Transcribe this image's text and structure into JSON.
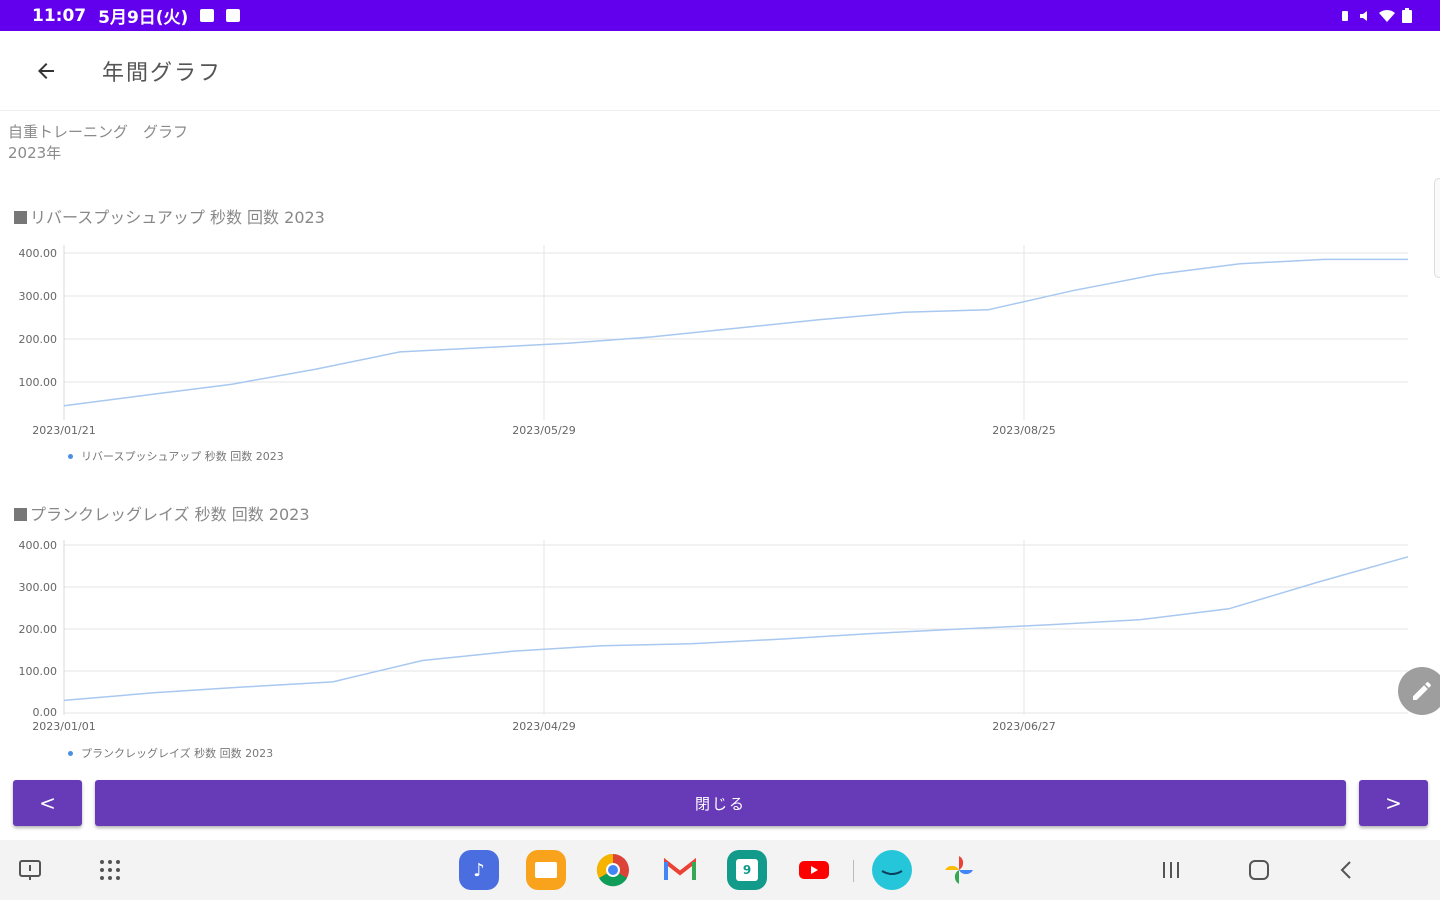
{
  "status": {
    "time": "11:07",
    "date": "5月9日(火)"
  },
  "app": {
    "title": "年間グラフ"
  },
  "subtitle": {
    "line1": "自重トレーニング　グラフ",
    "line2": "2023年"
  },
  "charts": [
    {
      "title": "リバースプッシュアップ 秒数 回数 2023",
      "legend": "リバースプッシュアップ 秒数 回数 2023",
      "yticks": [
        "400.00",
        "300.00",
        "200.00",
        "100.00"
      ],
      "xticks": [
        "2023/01/21",
        "2023/05/29",
        "2023/08/25"
      ]
    },
    {
      "title": "プランクレッグレイズ 秒数 回数 2023",
      "legend": "プランクレッグレイズ 秒数 回数 2023",
      "yticks": [
        "400.00",
        "300.00",
        "200.00",
        "100.00",
        "0.00"
      ],
      "xticks": [
        "2023/01/01",
        "2023/04/29",
        "2023/06/27"
      ]
    }
  ],
  "chart_data": [
    {
      "type": "line",
      "title": "リバースプッシュアップ 秒数 回数 2023",
      "ylim": [
        0,
        400
      ],
      "yticks": [
        100,
        200,
        300,
        400
      ],
      "grid": true,
      "legend_position": "bottom-left",
      "series": [
        {
          "name": "リバースプッシュアップ 秒数 回数 2023",
          "color": "#a8c8f0",
          "values": [
            45,
            70,
            95,
            130,
            170,
            180,
            190,
            205,
            225,
            245,
            262,
            268,
            312,
            350,
            375,
            385,
            385
          ]
        }
      ]
    },
    {
      "type": "line",
      "title": "プランクレッグレイズ 秒数 回数 2023",
      "ylim": [
        0,
        400
      ],
      "yticks": [
        0,
        100,
        200,
        300,
        400
      ],
      "grid": true,
      "legend_position": "bottom-left",
      "series": [
        {
          "name": "プランクレッグレイズ 秒数 回数 2023",
          "color": "#a8c8f0",
          "values": [
            30,
            48,
            62,
            74,
            125,
            147,
            160,
            165,
            176,
            189,
            200,
            210,
            222,
            248,
            312,
            372
          ]
        }
      ]
    }
  ],
  "buttons": {
    "prev": "<",
    "close": "閉じる",
    "next": ">"
  },
  "taskbar": {
    "apps": [
      "music-app",
      "files-app",
      "chrome-app",
      "gmail-app",
      "calendar-app",
      "youtube-app",
      "prime-video-app",
      "photos-app"
    ],
    "calendar_day": "9",
    "colors": {
      "accent": "#6200ee",
      "button": "#673ab7",
      "line": "#a8c8f0"
    }
  }
}
